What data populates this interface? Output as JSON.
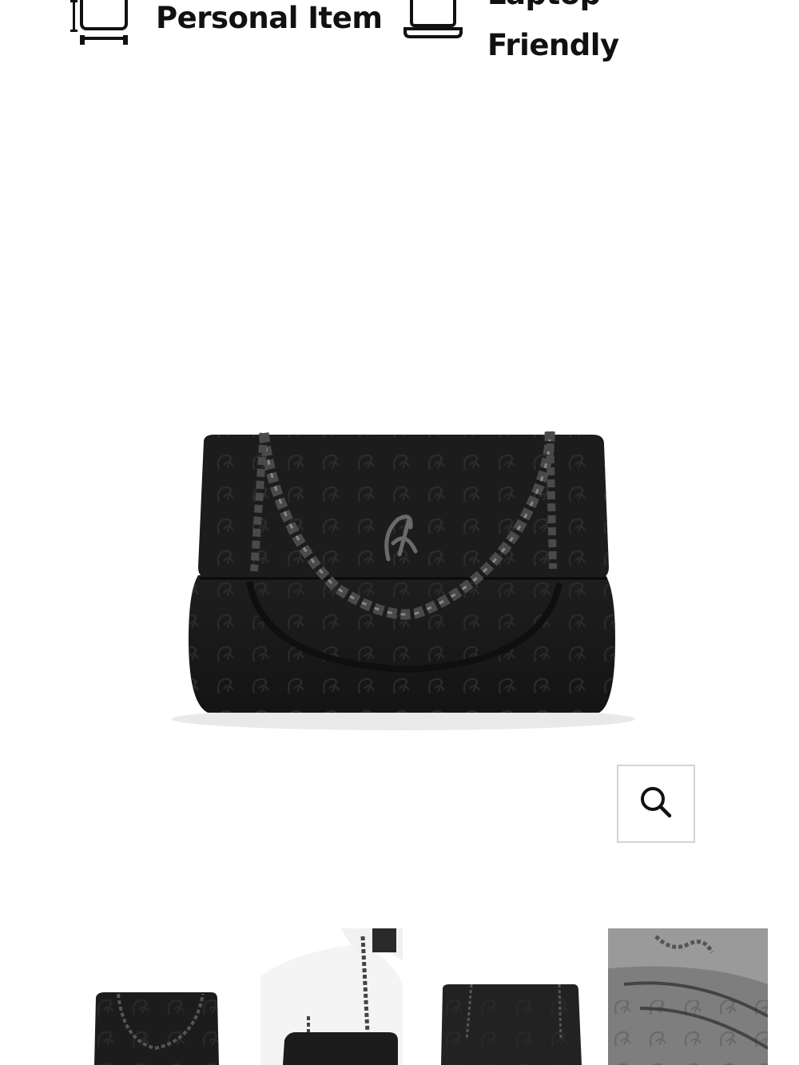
{
  "features": [
    {
      "label_line1": "Personal Item",
      "icon": "carry-on-bag-icon"
    },
    {
      "label_line1": "Laptop",
      "label_line2": "Friendly",
      "icon": "laptop-icon"
    }
  ],
  "product_image": {
    "alt": "Black embossed monogram chain shoulder bag"
  },
  "zoom": {
    "icon": "search-icon"
  },
  "thumbnails": [
    {
      "alt": "Bag front view"
    },
    {
      "alt": "Bag worn on shoulder"
    },
    {
      "alt": "Bag back view"
    },
    {
      "alt": "Bag interior view"
    }
  ],
  "colors": {
    "bag": "#1a1a1a",
    "chain": "#3a3a3a",
    "accent_border": "#d4d4d4"
  }
}
